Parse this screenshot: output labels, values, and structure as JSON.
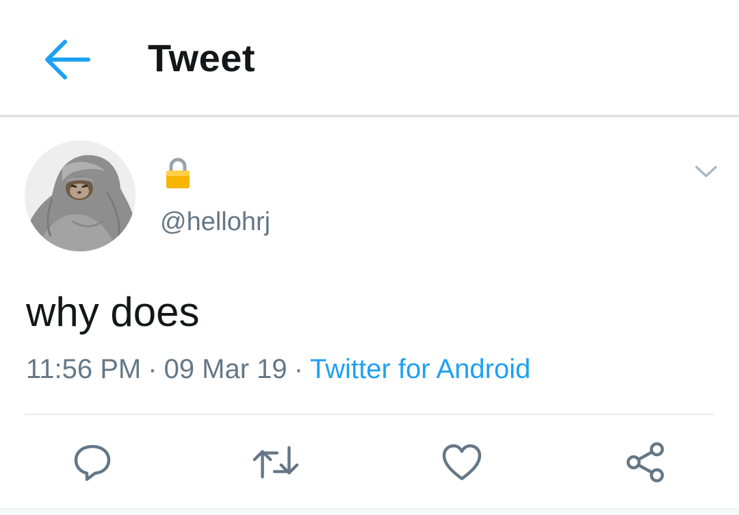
{
  "header": {
    "title": "Tweet",
    "back_icon": "arrow-left-icon",
    "accent_color": "#1da1f2"
  },
  "tweet": {
    "protected_icon": "lock-icon",
    "handle": "@hellohrj",
    "text": "why does",
    "time": "11:56 PM",
    "separator": "·",
    "date": "09 Mar 19",
    "source": "Twitter for Android",
    "menu_icon": "chevron-down-icon"
  },
  "actions": [
    {
      "name": "reply",
      "icon": "reply-icon"
    },
    {
      "name": "retweet",
      "icon": "retweet-icon"
    },
    {
      "name": "like",
      "icon": "heart-icon"
    },
    {
      "name": "share",
      "icon": "share-icon"
    }
  ],
  "colors": {
    "text_primary": "#14171a",
    "text_secondary": "#657786",
    "link": "#1da1f2",
    "divider": "#e6ecf0"
  }
}
